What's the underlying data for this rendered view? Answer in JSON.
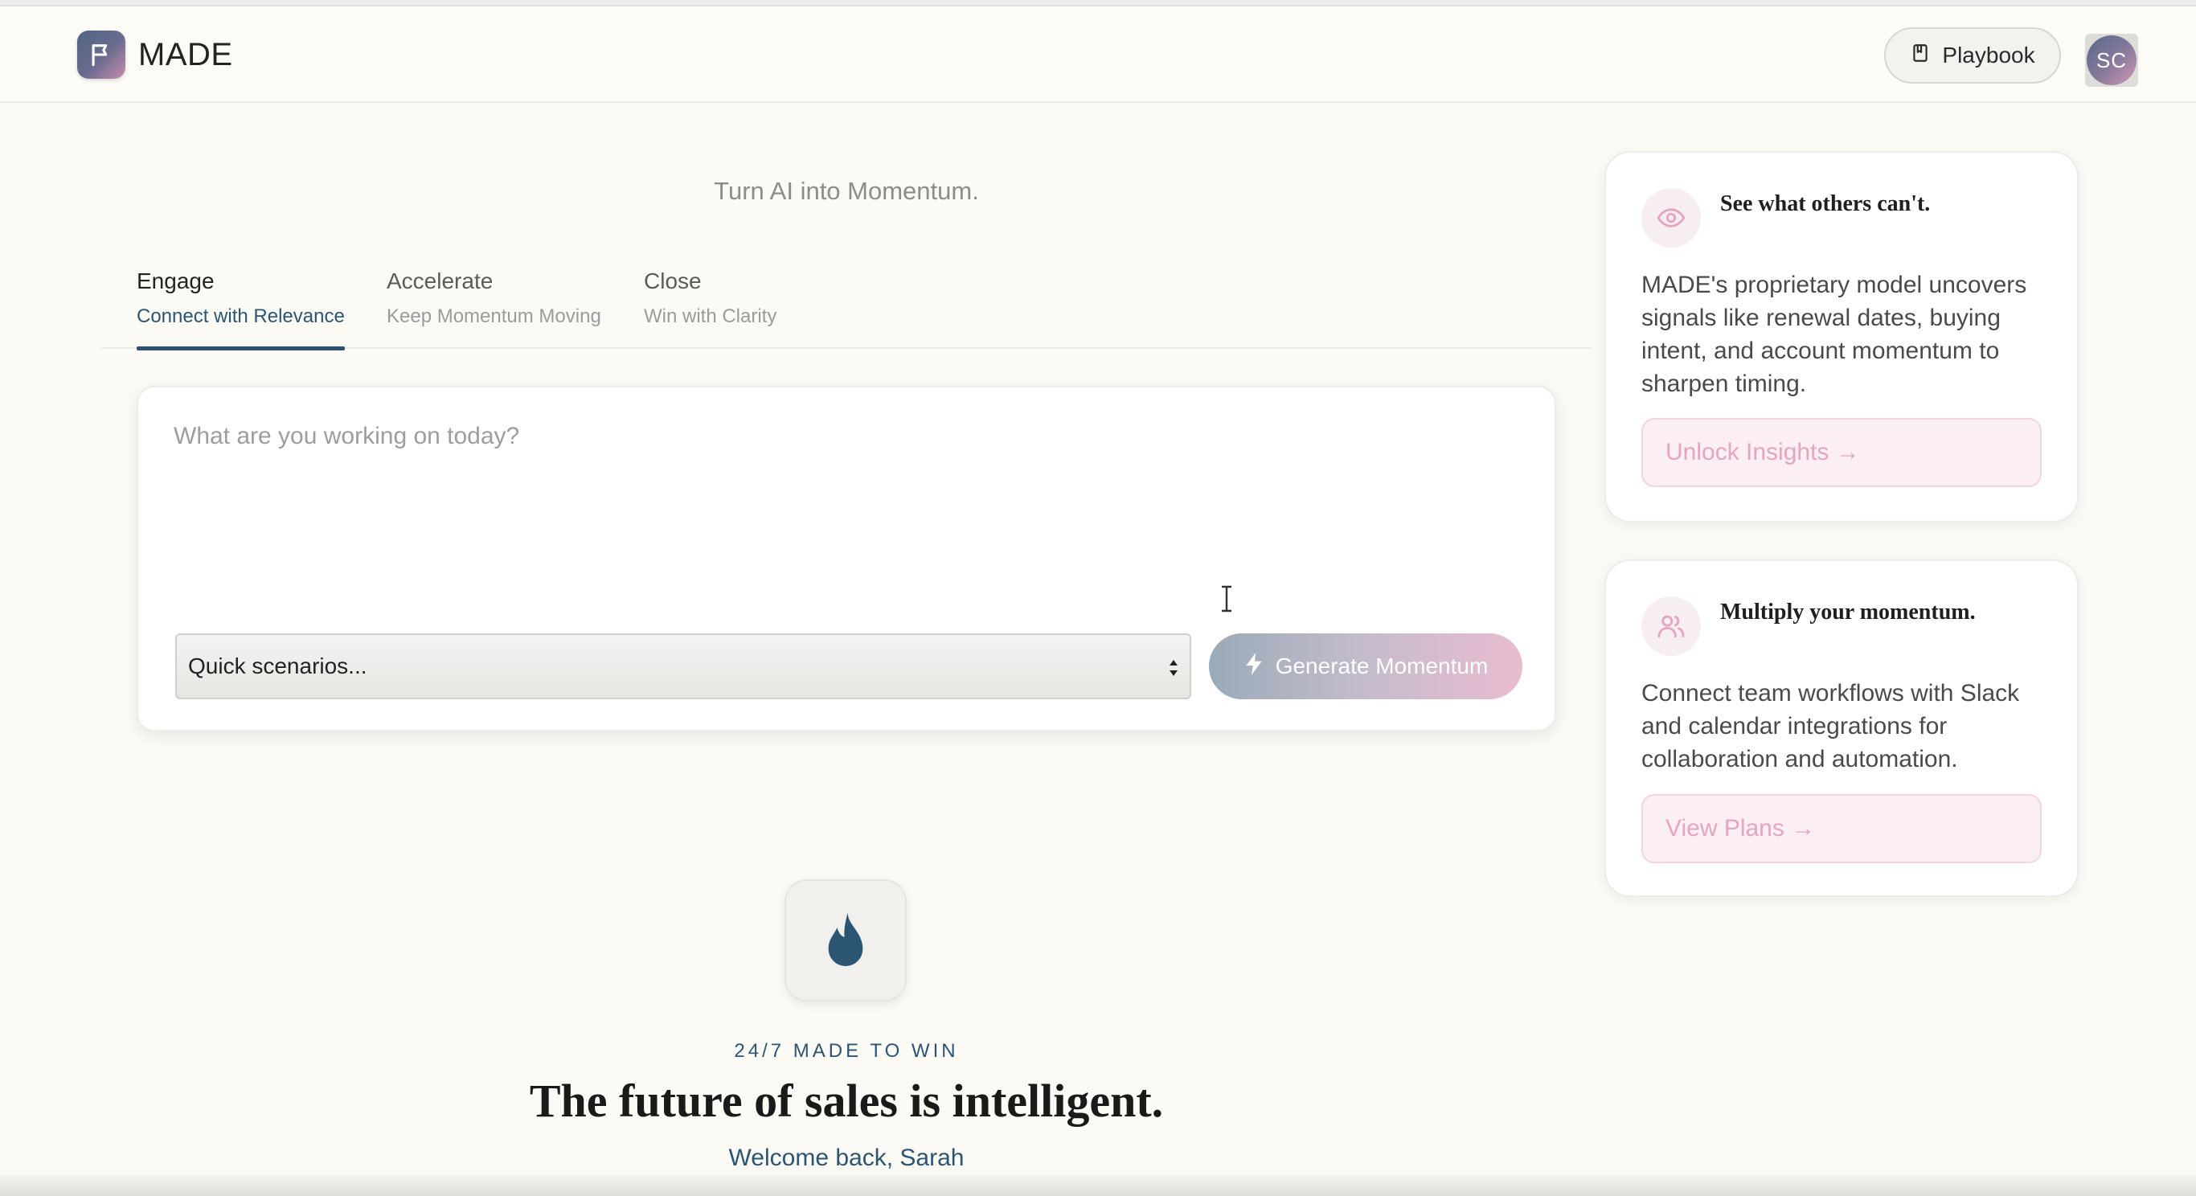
{
  "app": {
    "name": "MADE"
  },
  "header": {
    "playbook_label": "Playbook",
    "avatar_initials": "SC"
  },
  "tagline": "Turn AI into Momentum.",
  "tabs": [
    {
      "title": "Engage",
      "subtitle": "Connect with Relevance",
      "active": true
    },
    {
      "title": "Accelerate",
      "subtitle": "Keep Momentum Moving",
      "active": false
    },
    {
      "title": "Close",
      "subtitle": "Win with Clarity",
      "active": false
    }
  ],
  "composer": {
    "placeholder": "What are you working on today?",
    "value": "",
    "scenario_selected": "Quick scenarios...",
    "generate_label": "Generate Momentum"
  },
  "cards": [
    {
      "icon": "eye-icon",
      "title": "See what others can't.",
      "body": "MADE's proprietary model uncovers signals like renewal dates, buying intent, and account momentum to sharpen timing.",
      "button": "Unlock Insights →"
    },
    {
      "icon": "users-icon",
      "title": "Multiply your momentum.",
      "body": "Connect team workflows with Slack and calendar integrations for collaboration and automation.",
      "button": "View Plans →"
    }
  ],
  "hero": {
    "icon": "flame-icon",
    "kicker": "24/7 MADE TO WIN",
    "headline": "The future of sales is intelligent.",
    "welcome": "Welcome back, Sarah"
  },
  "colors": {
    "accent_navy": "#2c5574",
    "accent_pink": "#e5a4c0",
    "background": "#fbfaf5"
  }
}
